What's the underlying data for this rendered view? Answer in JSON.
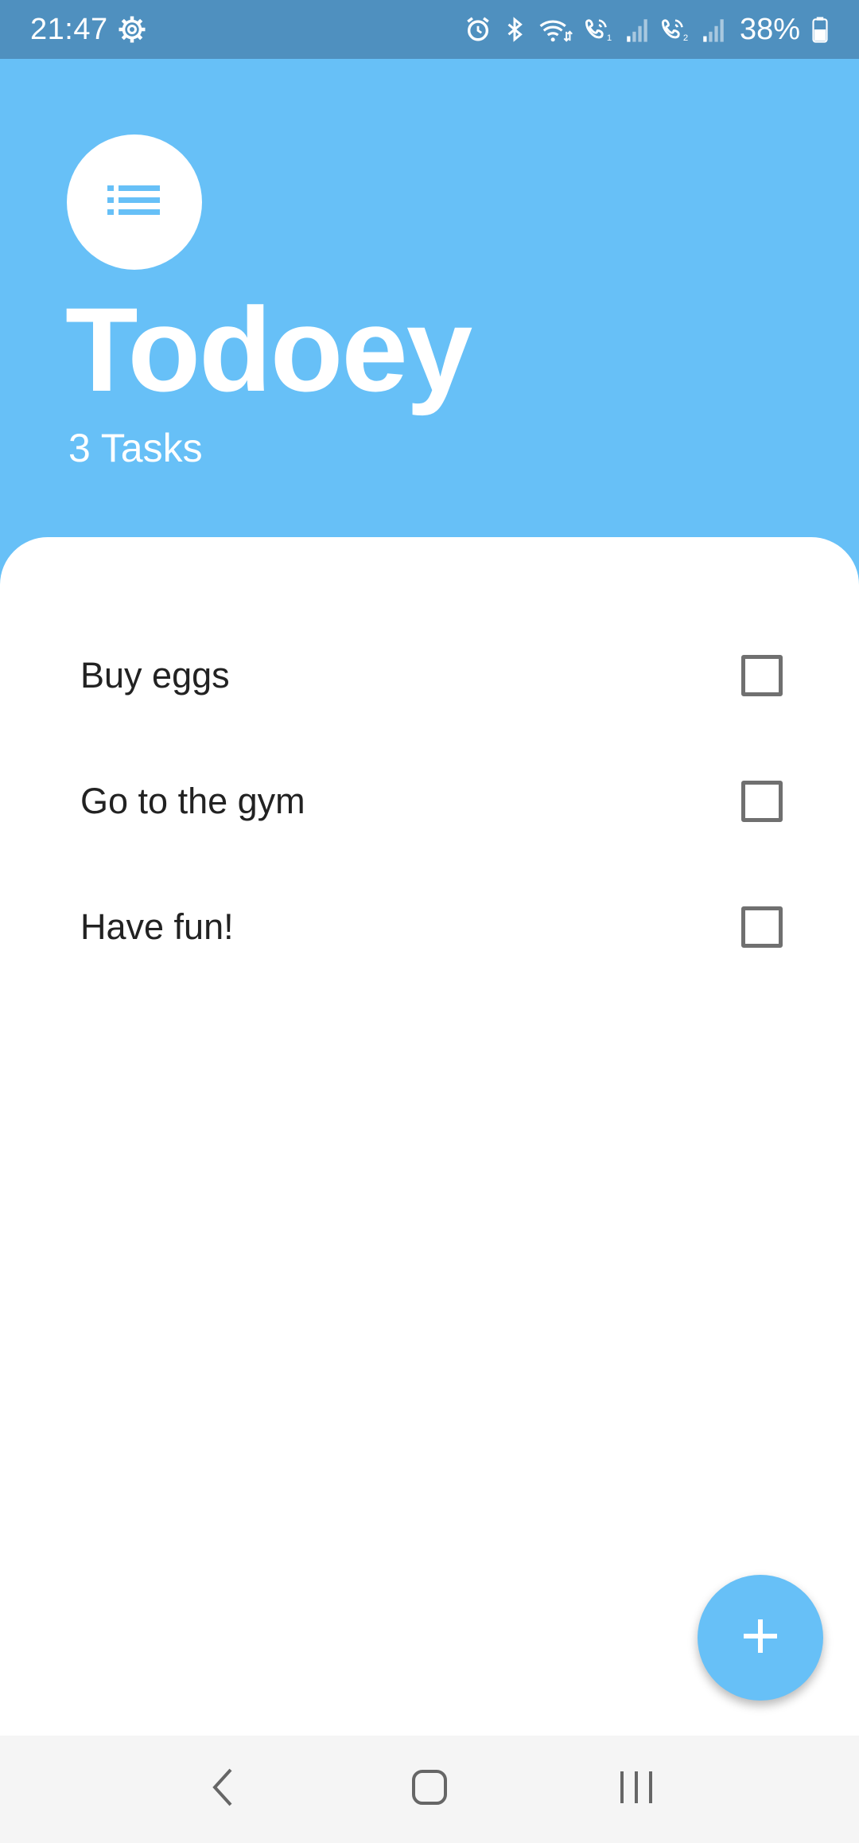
{
  "status_bar": {
    "time": "21:47",
    "battery": "38%",
    "icons": [
      "settings-icon",
      "alarm-icon",
      "bluetooth-icon",
      "wifi-icon",
      "volte-sim1-icon",
      "signal-sim1-icon",
      "volte-sim2-icon",
      "signal-sim2-icon",
      "battery-icon"
    ]
  },
  "header": {
    "icon": "list-icon",
    "title": "Todoey",
    "task_count": "3 Tasks"
  },
  "tasks": [
    {
      "label": "Buy eggs",
      "checked": false
    },
    {
      "label": "Go to the gym",
      "checked": false
    },
    {
      "label": "Have fun!",
      "checked": false
    }
  ],
  "fab": {
    "icon": "plus-icon"
  },
  "nav_bar": {
    "icons": [
      "back-icon",
      "home-icon",
      "recents-icon"
    ]
  },
  "colors": {
    "accent": "#67c0f7",
    "status_bar": "#4f90bf",
    "nav_bar": "#f5f5f5",
    "checkbox_border": "#707070"
  }
}
